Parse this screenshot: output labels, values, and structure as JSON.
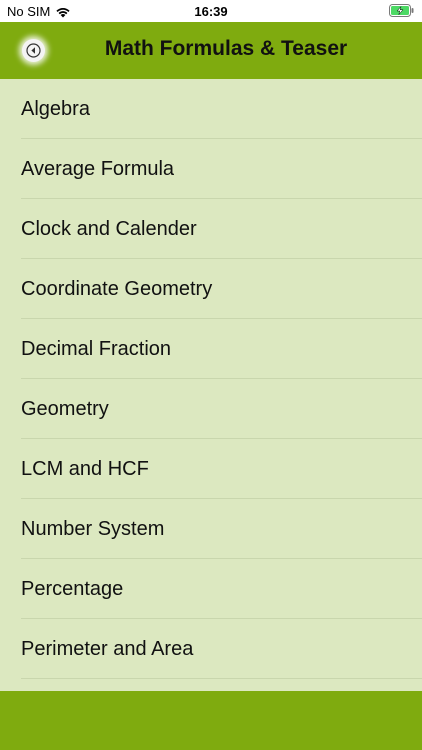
{
  "status_bar": {
    "carrier": "No SIM",
    "time": "16:39"
  },
  "header": {
    "title": "Math Formulas & Teaser"
  },
  "topics": [
    {
      "label": "Algebra"
    },
    {
      "label": "Average Formula"
    },
    {
      "label": "Clock and Calender"
    },
    {
      "label": "Coordinate Geometry"
    },
    {
      "label": "Decimal Fraction"
    },
    {
      "label": "Geometry"
    },
    {
      "label": "LCM and HCF"
    },
    {
      "label": "Number System"
    },
    {
      "label": "Percentage"
    },
    {
      "label": "Perimeter and Area"
    }
  ],
  "icons": {
    "back": "back-arrow-icon",
    "wifi": "wifi-icon",
    "battery": "battery-charging-icon"
  },
  "colors": {
    "bar_green": "#7fab0f",
    "list_background": "#dce8c0",
    "battery_green": "#4cd964"
  }
}
